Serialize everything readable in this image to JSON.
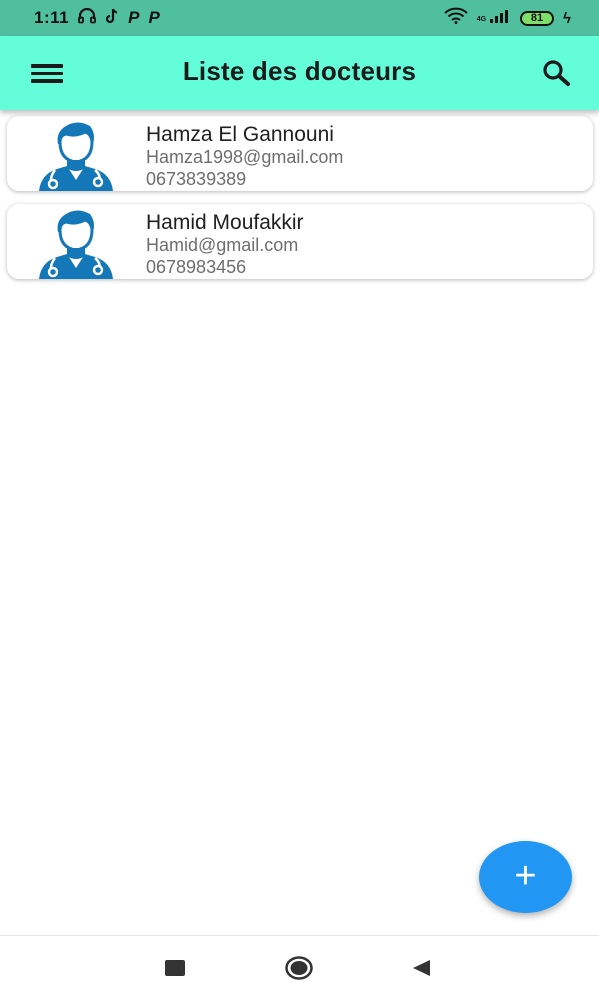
{
  "status_bar": {
    "time": "1:11",
    "icons": [
      "headset-icon",
      "tiktok-icon",
      "p-app-icon",
      "p-app-icon",
      "wifi-icon",
      "signal-4g-icon",
      "battery-icon",
      "charging-bolt-icon"
    ],
    "app_letter_1": "P",
    "app_letter_2": "P",
    "network": "4G",
    "battery_level": "81"
  },
  "app_bar": {
    "title": "Liste des docteurs",
    "background": "#64fdd9",
    "menu_icon": "hamburger-menu-icon",
    "search_icon": "search-icon"
  },
  "doctors": [
    {
      "name": "Hamza El Gannouni",
      "email": "Hamza1998@gmail.com",
      "phone": "0673839389",
      "avatar_icon": "doctor-avatar-icon"
    },
    {
      "name": "Hamid Moufakkir",
      "email": "Hamid@gmail.com",
      "phone": "0678983456",
      "avatar_icon": "doctor-avatar-icon"
    }
  ],
  "fab": {
    "label": "+",
    "color": "#2196f3",
    "icon": "add-icon"
  },
  "nav_bar": {
    "icons": [
      "recents-square-icon",
      "home-circle-icon",
      "back-triangle-icon"
    ]
  },
  "colors": {
    "status_bar": "#4fbf9e",
    "avatar": "#1478b8",
    "battery_fill": "#7ee06a"
  }
}
